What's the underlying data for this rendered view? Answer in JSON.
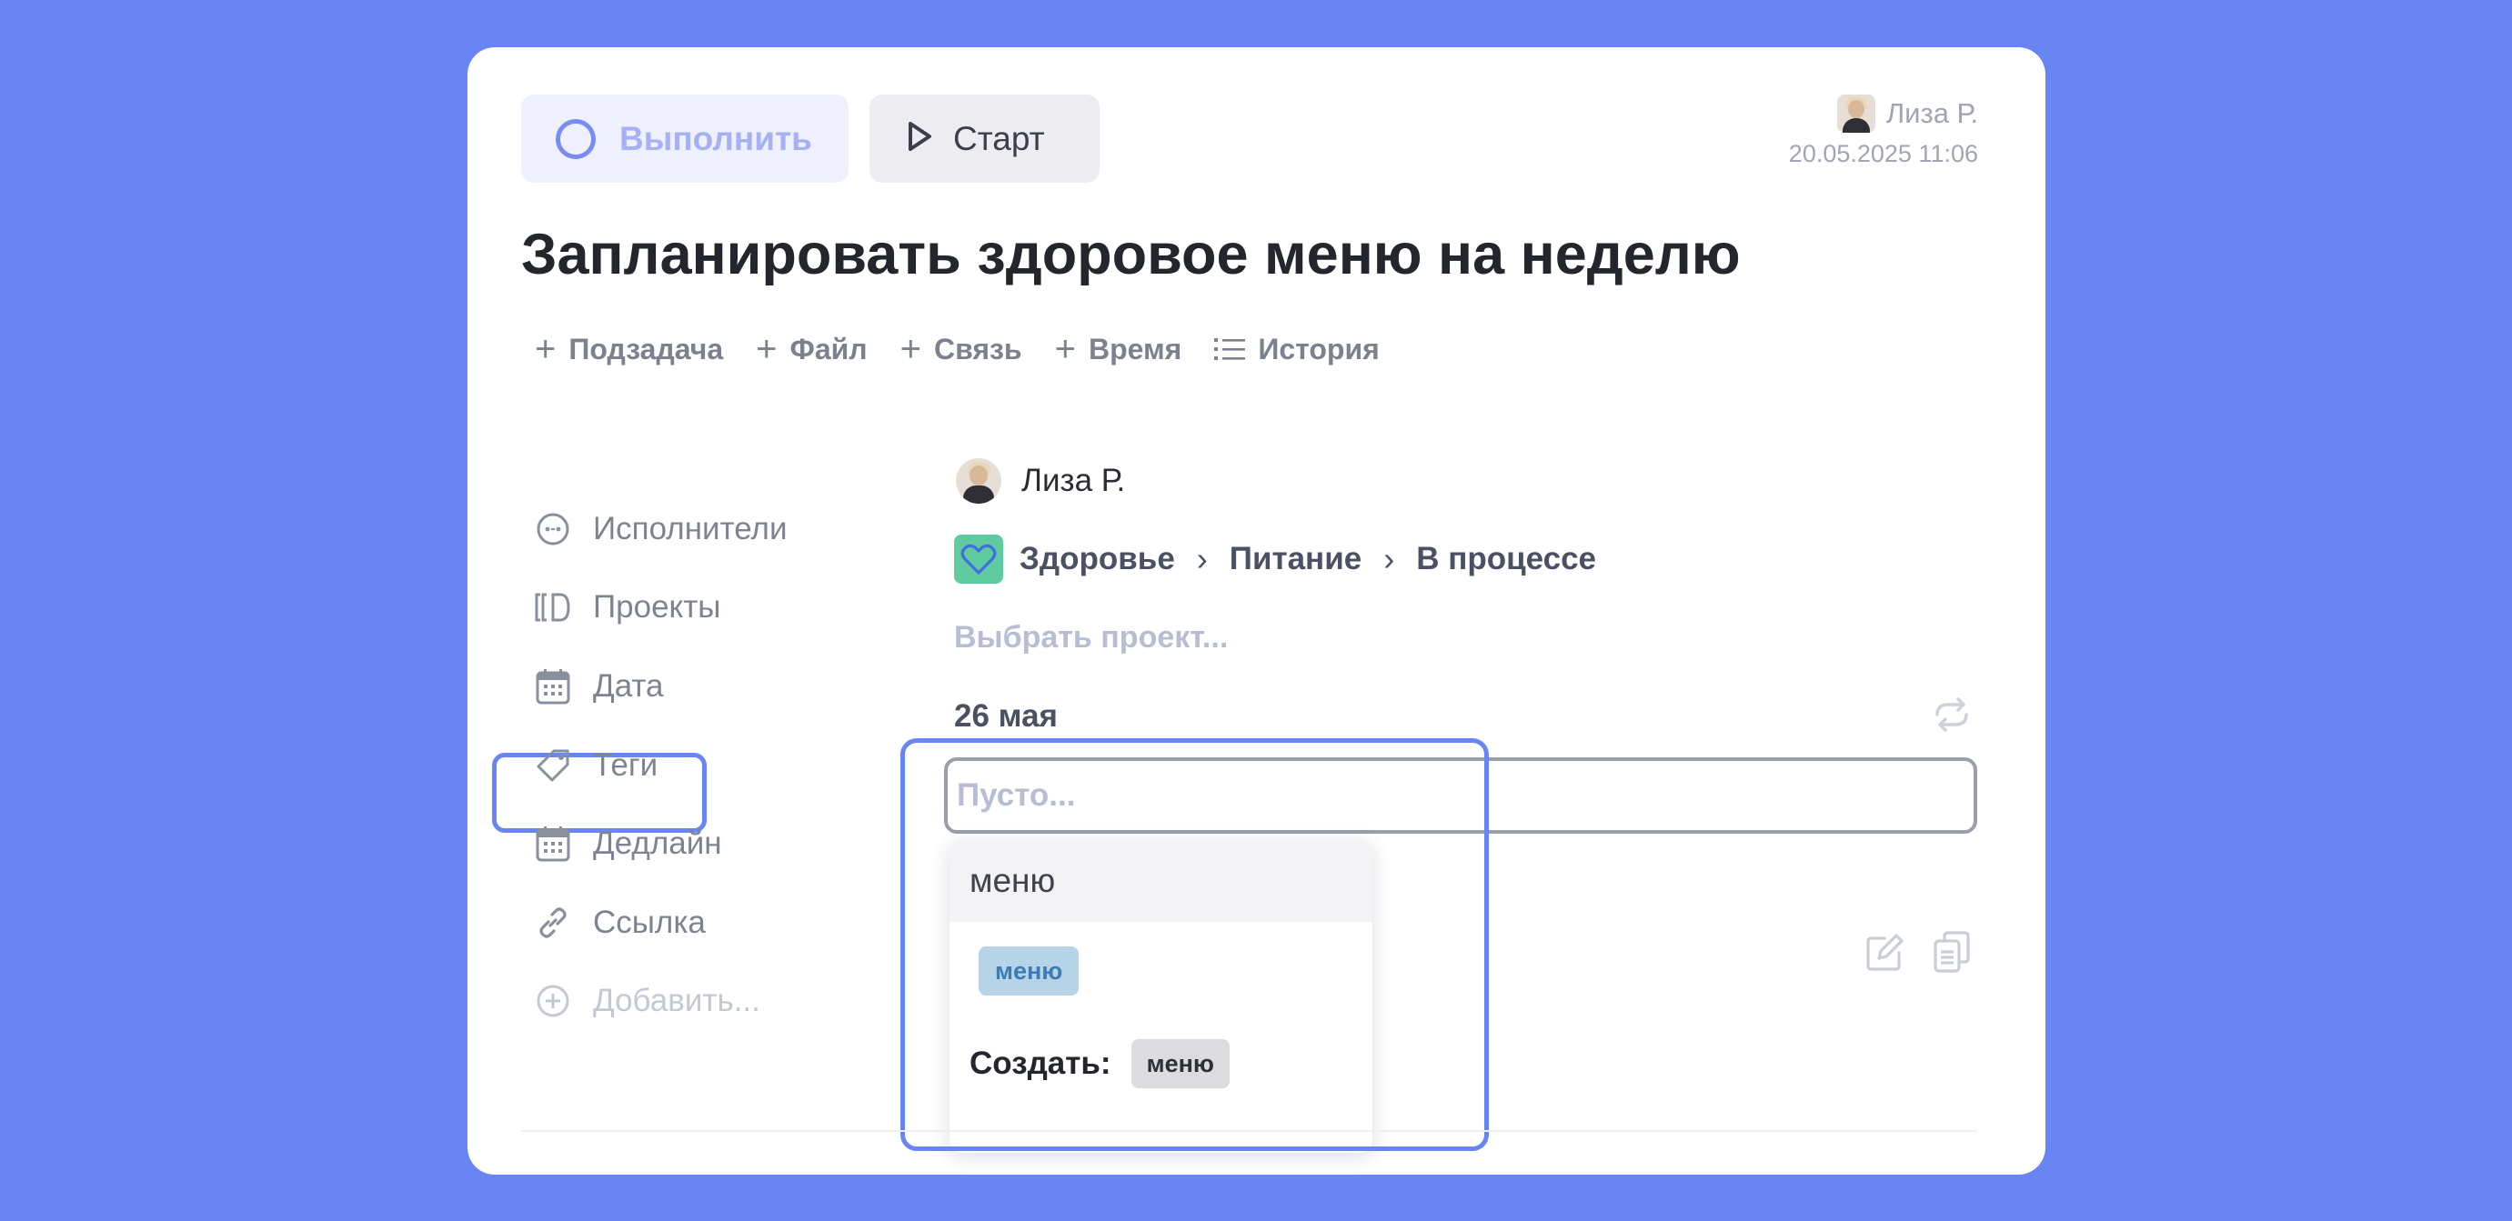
{
  "toolbar": {
    "complete_label": "Выполнить",
    "start_label": "Старт"
  },
  "author": {
    "name": "Лиза Р.",
    "date": "20.05.2025 11:06"
  },
  "task": {
    "title": "Запланировать здоровое меню на неделю"
  },
  "actions": [
    {
      "label": "Подзадача"
    },
    {
      "label": "Файл"
    },
    {
      "label": "Связь"
    },
    {
      "label": "Время"
    },
    {
      "label": "История"
    }
  ],
  "properties": {
    "assignees": {
      "label": "Исполнители",
      "value": "Лиза Р."
    },
    "projects": {
      "label": "Проекты",
      "path": [
        "Здоровье",
        "Питание",
        "В процессе"
      ],
      "choose_placeholder": "Выбрать проект..."
    },
    "date": {
      "label": "Дата",
      "value": "26 мая"
    },
    "tags": {
      "label": "Теги",
      "placeholder": "Пусто..."
    },
    "deadline": {
      "label": "Дедлайн"
    },
    "link": {
      "label": "Ссылка"
    },
    "add": {
      "label": "Добавить..."
    }
  },
  "tag_dropdown": {
    "query": "меню",
    "existing_tag": "меню",
    "create_label": "Создать:",
    "create_tag": "меню"
  },
  "colors": {
    "background": "#6885F3",
    "accent": "#6885F3",
    "project_icon": "#5FC9A0",
    "tag_chip": "#B7D3E7"
  }
}
